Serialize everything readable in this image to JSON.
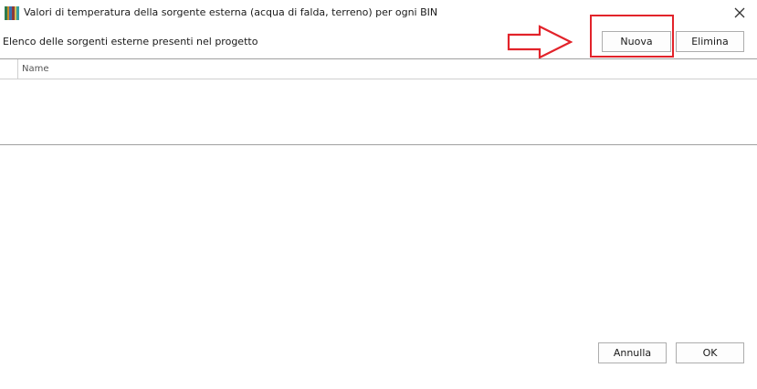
{
  "window": {
    "title": "Valori di temperatura della sorgente esterna (acqua di falda, terreno) per ogni BIN",
    "icon": "bar-stripes-app-icon",
    "close_icon": "close-icon"
  },
  "header": {
    "subtitle": "Elenco delle sorgenti esterne presenti nel progetto",
    "new_label": "Nuova",
    "delete_label": "Elimina"
  },
  "grid": {
    "columns": [
      "Name"
    ],
    "rows": []
  },
  "footer": {
    "cancel_label": "Annulla",
    "ok_label": "OK"
  },
  "annotations": {
    "highlight_color": "#e2232a",
    "arrow_color": "#e2232a"
  }
}
